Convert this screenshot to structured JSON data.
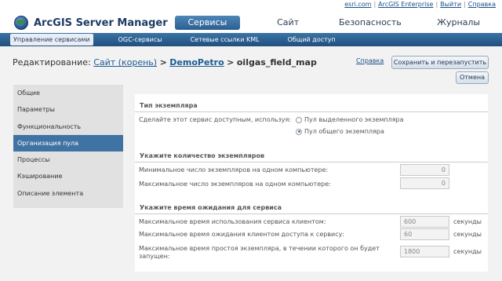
{
  "toplinks": [
    "esri.com",
    "ArcGIS Enterprise",
    "Выйти",
    "Справка"
  ],
  "app_title": "ArcGIS Server Manager",
  "main_tabs": [
    "Сервисы",
    "Сайт",
    "Безопасность",
    "Журналы"
  ],
  "sub_tabs": [
    "Управление сервисами",
    "OGC-сервисы",
    "Сетевые ссылки KML",
    "Общий доступ"
  ],
  "breadcrumb": {
    "prefix": "Редактирование:",
    "root": "Сайт (корень)",
    "sep1": ">",
    "folder": "DemoPetro",
    "sep2": ">",
    "service": "oilgas_field_map"
  },
  "help_link": "Справка",
  "save_button": "Сохранить и перезапустить",
  "cancel_button": "Отмена",
  "sidebar": [
    "Общие",
    "Параметры",
    "Функциональность",
    "Организация пула",
    "Процессы",
    "Кэширование",
    "Описание элемента"
  ],
  "sidebar_active_index": 3,
  "instance_type": {
    "title": "Тип экземпляра",
    "prompt": "Сделайте этот сервис доступным, используя:",
    "option_dedicated": "Пул выделенного экземпляра",
    "option_shared": "Пул общего экземпляра",
    "selected": "shared"
  },
  "instance_count": {
    "title": "Укажите количество экземпляров",
    "min_label": "Минимальное число экземпляров на одном компьютере:",
    "min_value": "0",
    "max_label": "Максимальное число экземпляров на одном компьютере:",
    "max_value": "0"
  },
  "timeouts": {
    "title": "Укажите время ожидания для сервиса",
    "usage_label": "Максимальное время использования сервиса клиентом:",
    "usage_value": "600",
    "wait_label": "Максимальное время ожидания клиентом доступа к сервису:",
    "wait_value": "60",
    "idle_label_line1": "Максимальное время простоя экземпляра, в течении которого он будет",
    "idle_label_line2": "запущен:",
    "idle_value": "1800",
    "unit": "секунды"
  }
}
